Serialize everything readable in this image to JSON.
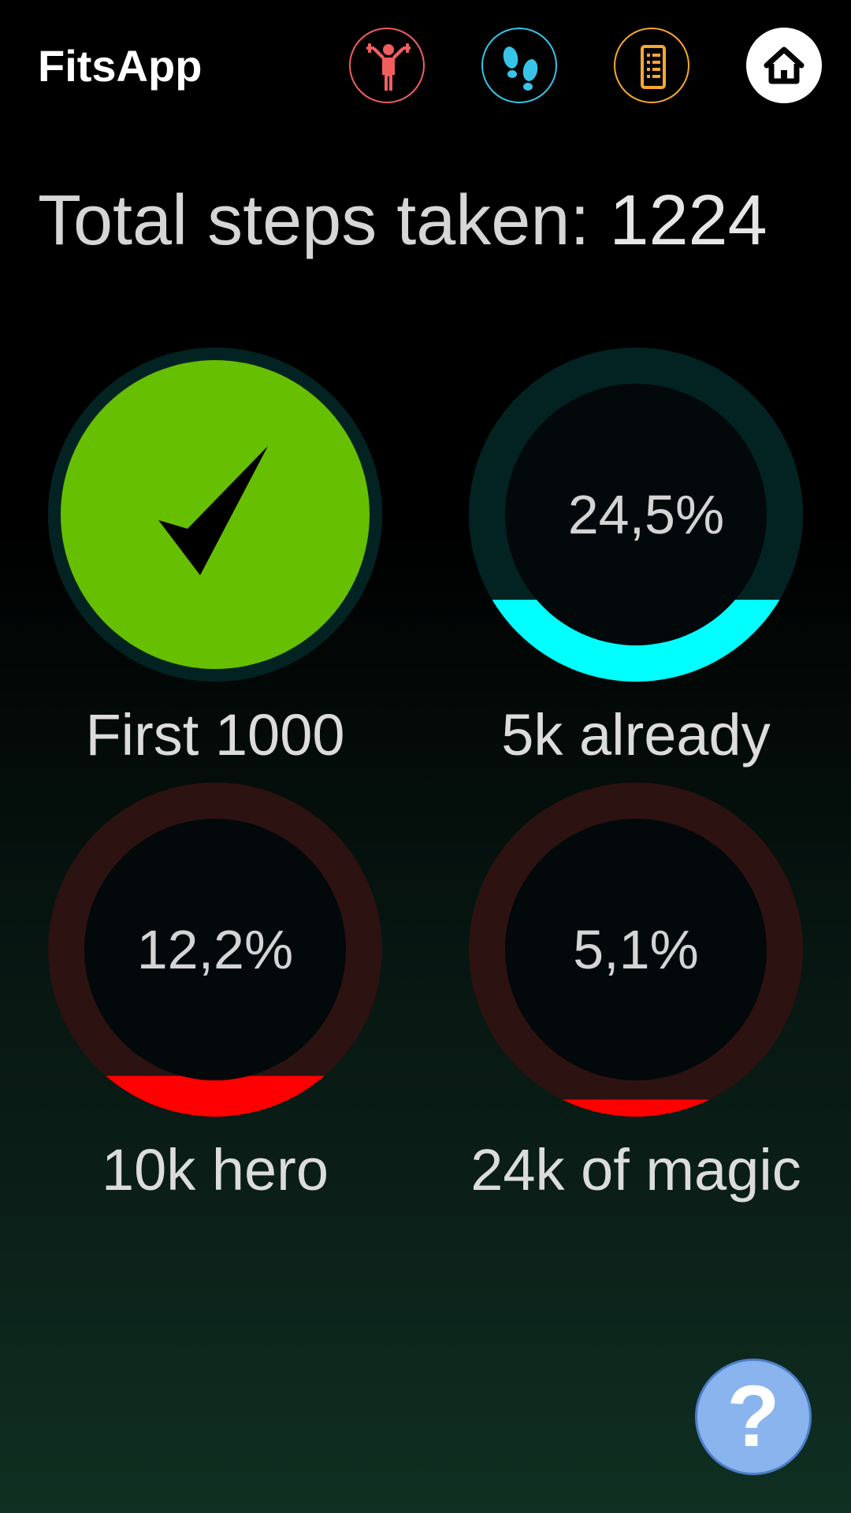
{
  "app": {
    "title": "FitsApp"
  },
  "nav": [
    {
      "icon": "workout-person-icon",
      "color": "#f15e5e"
    },
    {
      "icon": "footprints-icon",
      "color": "#38c4e8"
    },
    {
      "icon": "list-clipboard-icon",
      "color": "#f7a733"
    },
    {
      "icon": "home-icon",
      "color": "#ffffff"
    }
  ],
  "summary": {
    "label": "Total steps taken: ",
    "value": "1224"
  },
  "goals": [
    {
      "name": "First 1000",
      "percent_text": "",
      "progress": 1.0,
      "completed": true,
      "fill_color": "#66bf00",
      "track_color": "#022322"
    },
    {
      "name": "5k already",
      "percent_text": "24,5%",
      "progress": 0.245,
      "completed": false,
      "fill_color": "#00ffff",
      "track_color": "#022322"
    },
    {
      "name": "10k hero",
      "percent_text": "12,2%",
      "progress": 0.122,
      "completed": false,
      "fill_color": "#ff0000",
      "track_color": "#2c1210"
    },
    {
      "name": "24k of magic",
      "percent_text": "5,1%",
      "progress": 0.051,
      "completed": false,
      "fill_color": "#ff0000",
      "track_color": "#2c1210"
    }
  ],
  "help": {
    "label": "?"
  }
}
